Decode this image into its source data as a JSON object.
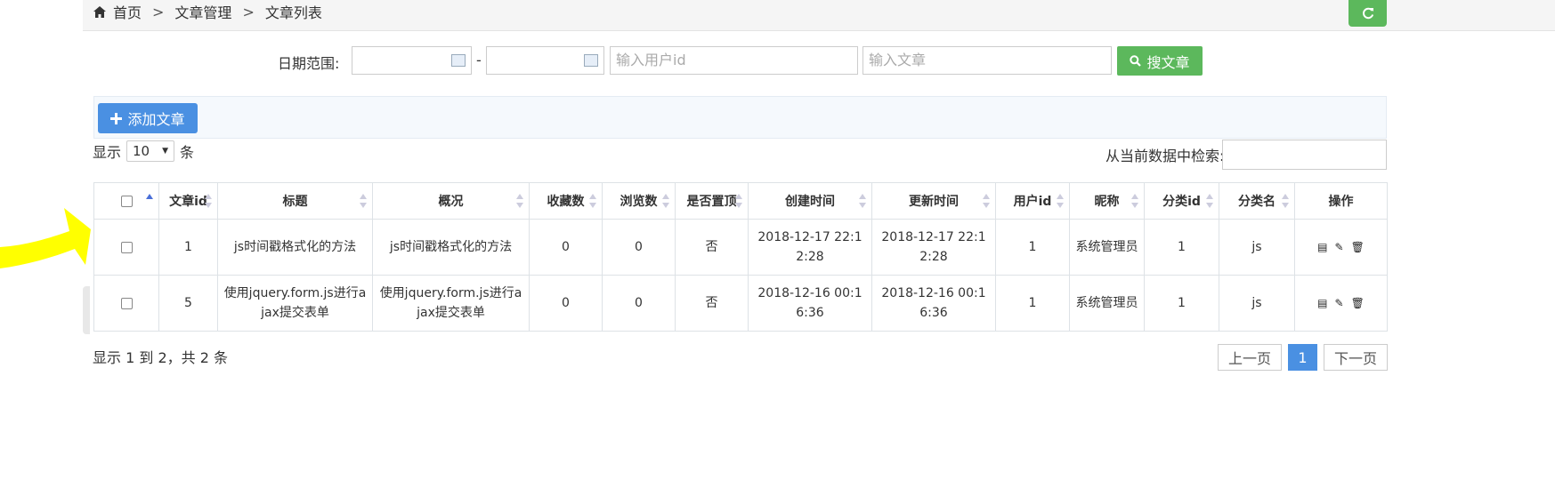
{
  "breadcrumb": {
    "home": "首页",
    "sep": ">",
    "level1": "文章管理",
    "level2": "文章列表"
  },
  "filters": {
    "date_label": "日期范围:",
    "date_sep": "-",
    "start_value": "",
    "end_value": "",
    "user_placeholder": "输入用户id",
    "article_placeholder": "输入文章",
    "search_label": "搜文章"
  },
  "toolbar": {
    "add_label": "添加文章"
  },
  "page_size": {
    "prefix": "显示",
    "value": "10",
    "suffix": "条"
  },
  "table_search": {
    "label": "从当前数据中检索:",
    "value": ""
  },
  "columns": [
    "文章id",
    "标题",
    "概况",
    "收藏数",
    "浏览数",
    "是否置顶",
    "创建时间",
    "更新时间",
    "用户id",
    "昵称",
    "分类id",
    "分类名",
    "操作"
  ],
  "rows": [
    {
      "id": "1",
      "title": "js时间戳格式化的方法",
      "summary": "js时间戳格式化的方法",
      "favorites": "0",
      "views": "0",
      "top": "否",
      "created": "2018-12-17 22:12:28",
      "updated": "2018-12-17 22:12:28",
      "user_id": "1",
      "nickname": "系统管理员",
      "cat_id": "1",
      "cat_name": "js"
    },
    {
      "id": "5",
      "title": "使用jquery.form.js进行ajax提交表单",
      "summary": "使用jquery.form.js进行ajax提交表单",
      "favorites": "0",
      "views": "0",
      "top": "否",
      "created": "2018-12-16 00:16:36",
      "updated": "2018-12-16 00:16:36",
      "user_id": "1",
      "nickname": "系统管理员",
      "cat_id": "1",
      "cat_name": "js"
    }
  ],
  "footer": {
    "info": "显示 1 到 2，共 2 条",
    "prev": "上一页",
    "current": "1",
    "next": "下一页"
  },
  "icons": {
    "home": "home-icon",
    "refresh": "refresh-icon",
    "calendar": "calendar-icon",
    "search": "search-icon",
    "plus": "plus-icon",
    "view": "view-icon",
    "edit": "pencil-icon",
    "delete": "trash-icon"
  },
  "colors": {
    "success": "#5cb85c",
    "primary": "#4a90e2",
    "annotation_arrow": "#ffff00"
  }
}
